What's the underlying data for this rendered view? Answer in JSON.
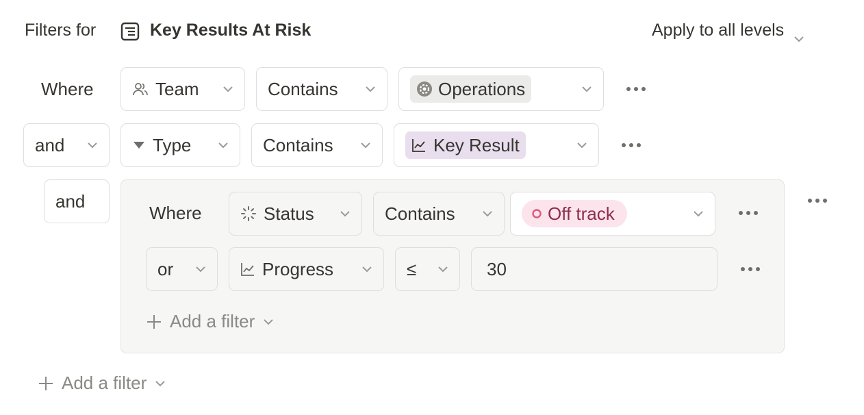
{
  "header": {
    "filters_for_label": "Filters for",
    "view_title": "Key Results At Risk",
    "apply_label": "Apply to all levels"
  },
  "rows": [
    {
      "connector": "Where",
      "property": "Team",
      "operator": "Contains",
      "value": "Operations",
      "value_color": "#ebebea"
    },
    {
      "connector": "and",
      "property": "Type",
      "operator": "Contains",
      "value": "Key Result",
      "value_color": "#e8deee"
    }
  ],
  "group": {
    "connector": "and",
    "rows": [
      {
        "connector": "Where",
        "property": "Status",
        "operator": "Contains",
        "value": "Off track",
        "value_color": "#fbe4ec",
        "value_text_color": "#8e2e4c"
      },
      {
        "connector": "or",
        "property": "Progress",
        "operator": "≤",
        "value": "30"
      }
    ],
    "add_filter_label": "Add a filter"
  },
  "add_filter_label": "Add a filter",
  "icons": {
    "view": "list-view-icon",
    "team": "people-icon",
    "type": "triangle-down-icon",
    "operations": "gear-icon",
    "key_result": "chart-line-icon",
    "status": "loading-spinner-icon",
    "off_track": "circle-outline-icon",
    "progress": "chart-line-icon",
    "more": "ellipsis-icon",
    "add": "plus-icon"
  }
}
